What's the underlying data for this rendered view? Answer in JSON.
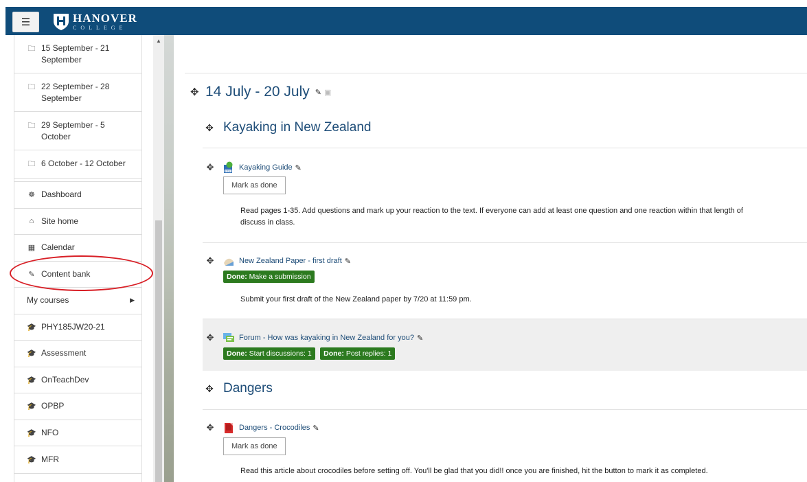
{
  "navbar": {
    "menu_icon": "hamburger-icon",
    "logo_name": "HANOVER",
    "logo_sub": "COLLEGE",
    "color": "#0f4c7a"
  },
  "drawer": {
    "weeks": [
      {
        "label": "15 September - 21 September"
      },
      {
        "label": "22 September - 28 September"
      },
      {
        "label": "29 September - 5 October"
      },
      {
        "label": "6 October - 12 October"
      }
    ],
    "nav": [
      {
        "icon": "dashboard-icon",
        "glyph": "☸",
        "label": "Dashboard"
      },
      {
        "icon": "home-icon",
        "glyph": "⌂",
        "label": "Site home"
      },
      {
        "icon": "calendar-icon",
        "glyph": "▦",
        "label": "Calendar"
      },
      {
        "icon": "brush-icon",
        "glyph": "✎",
        "label": "Content bank"
      }
    ],
    "my_courses_label": "My courses",
    "courses": [
      {
        "label": "PHY185JW20-21"
      },
      {
        "label": "Assessment"
      },
      {
        "label": "OnTeachDev"
      },
      {
        "label": "OPBP"
      },
      {
        "label": "NFO"
      },
      {
        "label": "MFR"
      }
    ]
  },
  "main": {
    "section_title": "14 July - 20 July",
    "subsections": [
      {
        "title": "Kayaking in New Zealand"
      },
      {
        "title": "Dangers"
      }
    ],
    "activities": [
      {
        "title": "Kayaking Guide",
        "icon": "pdf-icon",
        "button": "Mark as done",
        "description": "Read pages 1-35. Add questions and mark up your reaction to the text. If everyone can add at least one question and one reaction within that length of",
        "description2": "discuss in class."
      },
      {
        "title": "New Zealand Paper - first draft",
        "icon": "assignment-icon",
        "badges": [
          {
            "strong": "Done:",
            "text": " Make a submission"
          }
        ],
        "description": "Submit your first draft of the New Zealand paper by 7/20 at 11:59 pm."
      },
      {
        "title": "Forum - How was kayaking in New Zealand for you?",
        "icon": "forum-icon",
        "badges": [
          {
            "strong": "Done:",
            "text": " Start discussions: 1"
          },
          {
            "strong": "Done:",
            "text": " Post replies: 1"
          }
        ]
      },
      {
        "title": "Dangers - Crocodiles",
        "icon": "file-icon",
        "button": "Mark as done",
        "description": "Read this article about crocodiles before setting off. You'll be glad that you did!! once you are finished, hit the button to mark it as completed."
      }
    ]
  },
  "colors": {
    "accent": "#1e4d78",
    "done_badge": "#2c7a1f",
    "highlight": "#d81f26"
  }
}
